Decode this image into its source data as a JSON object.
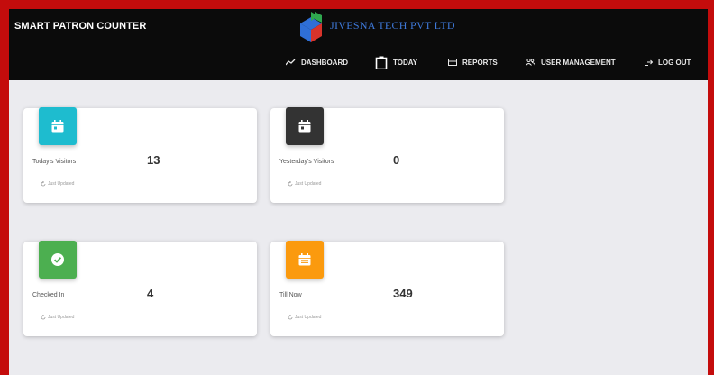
{
  "header": {
    "app_title": "SMART PATRON COUNTER",
    "company_name": "JIVESNA TECH PVT LTD",
    "logo_colors": [
      "#2fa84f",
      "#2f6fd6",
      "#d9342b"
    ]
  },
  "nav": {
    "items": [
      {
        "label": "DASHBOARD",
        "icon": "trend-icon"
      },
      {
        "label": "TODAY",
        "icon": "clipboard-icon"
      },
      {
        "label": "REPORTS",
        "icon": "reports-icon"
      },
      {
        "label": "USER MANAGEMENT",
        "icon": "users-icon"
      },
      {
        "label": "LOG OUT",
        "icon": "logout-icon"
      }
    ]
  },
  "cards": [
    {
      "label": "Today's Visitors",
      "value": "13",
      "footer": "Just Updated",
      "icon": "calendar-icon",
      "color": "#1ebccf"
    },
    {
      "label": "Yesterday's Visitors",
      "value": "0",
      "footer": "Just Updated",
      "icon": "calendar-icon",
      "color": "#333333"
    },
    {
      "label": "Checked In",
      "value": "4",
      "footer": "Just Updated",
      "icon": "check-circle-icon",
      "color": "#4caf50"
    },
    {
      "label": "Till Now",
      "value": "349",
      "footer": "Just Updated",
      "icon": "calendar-list-icon",
      "color": "#fb9a0e"
    }
  ],
  "colors": {
    "border": "#c40c0c",
    "header_bg": "#0b0b0b",
    "page_bg": "#ebebef",
    "company_text": "#3e78d8"
  }
}
